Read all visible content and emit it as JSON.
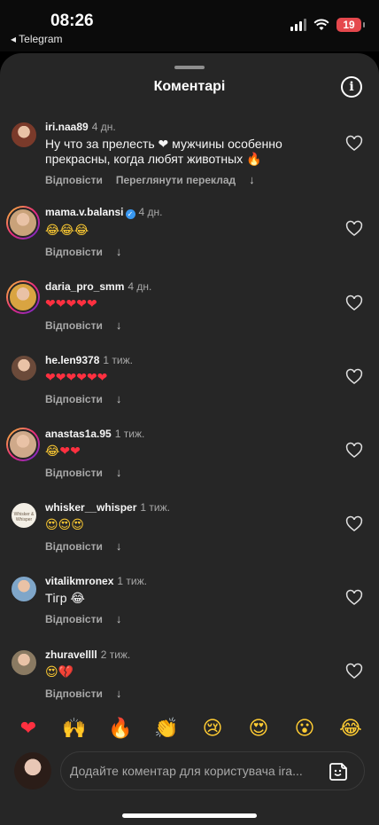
{
  "status_bar": {
    "time": "08:26",
    "back_app": "◂ Telegram",
    "battery": "19"
  },
  "sheet": {
    "title": "Коментарі",
    "info_icon": "i"
  },
  "comments": [
    {
      "username": "iri.naa89",
      "verified": false,
      "age": "4 дн.",
      "avatar_color": "#7a3a2a",
      "text_lines": [
        "Ну что за прелесть ❤ мужчины особенно",
        "прекрасны, когда любят животных 🔥"
      ],
      "reply": "Відповісти",
      "translate": "Переглянути переклад",
      "ring": false
    },
    {
      "username": "mama.v.balansi",
      "verified": true,
      "age": "4 дн.",
      "avatar_color": "#c9a27a",
      "emojis": "😂😂😂",
      "reply": "Відповісти",
      "ring": true
    },
    {
      "username": "daria_pro_smm",
      "verified": false,
      "age": "4 дн.",
      "avatar_color": "#d9a441",
      "emojis": "❤❤❤❤❤",
      "reply": "Відповісти",
      "ring": true
    },
    {
      "username": "he.len9378",
      "verified": false,
      "age": "1 тиж.",
      "avatar_color": "#6b4a3a",
      "emojis": "❤❤❤❤❤❤",
      "reply": "Відповісти",
      "ring": false
    },
    {
      "username": "anastas1a.95",
      "verified": false,
      "age": "1 тиж.",
      "avatar_color": "#cfa98a",
      "emojis": "😂❤❤",
      "reply": "Відповісти",
      "ring": true
    },
    {
      "username": "whisker__whisper",
      "verified": false,
      "age": "1 тиж.",
      "avatar_color": "#f3efe6",
      "avatar_text": "Whisker & Whisper",
      "emojis": "😍😍😍",
      "reply": "Відповісти",
      "ring": false
    },
    {
      "username": "vitalikmronex",
      "verified": false,
      "age": "1 тиж.",
      "avatar_color": "#7fa6c9",
      "text": "Тігр 😂",
      "reply": "Відповісти",
      "ring": false
    },
    {
      "username": "zhuravellll",
      "verified": false,
      "age": "2 тиж.",
      "avatar_color": "#8a7a62",
      "emojis": "😍💔",
      "reply": "Відповісти",
      "ring": false
    }
  ],
  "reactions": [
    "❤",
    "🙌",
    "🔥",
    "👏",
    "😢",
    "😍",
    "😮",
    "😂"
  ],
  "composer": {
    "placeholder": "Додайте коментар для користувача ira..."
  },
  "icons": {
    "like": "heart-outline-icon",
    "expand": "arrow-down-icon",
    "sticker": "sticker-icon",
    "info": "info-icon"
  }
}
